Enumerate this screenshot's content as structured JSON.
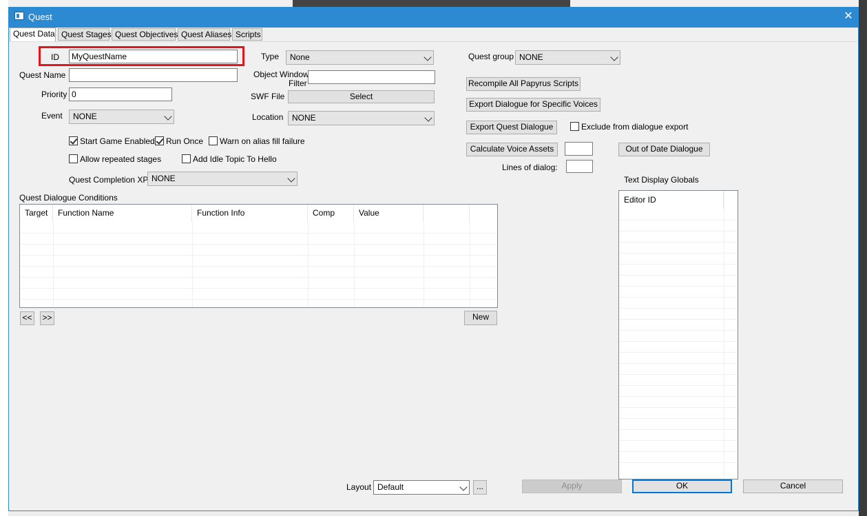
{
  "window": {
    "title": "Quest",
    "close_glyph": "✕"
  },
  "tabs": [
    {
      "label": "Quest Data",
      "active": true
    },
    {
      "label": "Quest Stages"
    },
    {
      "label": "Quest Objectives"
    },
    {
      "label": "Quest Aliases"
    },
    {
      "label": "Scripts"
    }
  ],
  "form": {
    "id_label": "ID",
    "id_value": "MyQuestName",
    "quest_name_label": "Quest Name",
    "quest_name_value": "",
    "priority_label": "Priority",
    "priority_value": "0",
    "event_label": "Event",
    "event_value": "NONE",
    "type_label": "Type",
    "type_value": "None",
    "object_window_filter_label_1": "Object Window",
    "object_window_filter_label_2": "Filter",
    "object_window_filter_value": "",
    "swf_file_label": "SWF File",
    "swf_select_label": "Select",
    "location_label": "Location",
    "location_value": "NONE",
    "quest_group_label": "Quest group",
    "quest_group_value": "NONE",
    "start_game_enabled": {
      "label": "Start Game Enabled",
      "checked": true
    },
    "run_once": {
      "label": "Run Once",
      "checked": true
    },
    "warn_alias": {
      "label": "Warn on alias fill failure",
      "checked": false
    },
    "allow_repeated": {
      "label": "Allow repeated stages",
      "checked": false
    },
    "add_idle_topic": {
      "label": "Add Idle Topic To Hello",
      "checked": false
    },
    "completion_xp_label": "Quest Completion XP",
    "completion_xp_value": "NONE"
  },
  "actions": {
    "recompile": "Recompile All Papyrus Scripts",
    "export_voices": "Export Dialogue for Specific Voices",
    "export_quest_dialogue": "Export Quest Dialogue",
    "exclude_export": {
      "label": "Exclude from dialogue export",
      "checked": false
    },
    "calc_voice_assets": "Calculate Voice Assets",
    "calc_voice_value": "",
    "out_of_date": "Out of Date Dialogue",
    "lines_of_dialog_label": "Lines of dialog:",
    "lines_of_dialog_value": ""
  },
  "conditions": {
    "label": "Quest Dialogue Conditions",
    "columns": [
      "Target",
      "Function Name",
      "Function Info",
      "Comp",
      "Value"
    ],
    "prev": "<<",
    "next": ">>",
    "new": "New"
  },
  "globals": {
    "label": "Text Display Globals",
    "columns": [
      "Editor ID"
    ]
  },
  "footer": {
    "layout_label": "Layout",
    "layout_value": "Default",
    "ellipsis": "...",
    "apply": "Apply",
    "ok": "OK",
    "cancel": "Cancel"
  },
  "colors": {
    "title_bar": "#2b8ad1",
    "highlight_box": "#e0161f",
    "default_button_border": "#0078d7"
  }
}
